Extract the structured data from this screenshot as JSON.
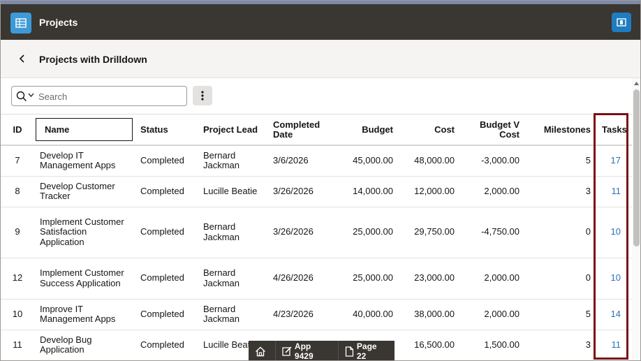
{
  "header": {
    "title": "Projects"
  },
  "subheader": {
    "title": "Projects with Drilldown"
  },
  "search": {
    "placeholder": "Search",
    "value": ""
  },
  "table": {
    "columns": [
      "ID",
      "Name",
      "Status",
      "Project Lead",
      "Completed Date",
      "Budget",
      "Cost",
      "Budget V Cost",
      "Milestones",
      "Tasks"
    ],
    "rows": [
      {
        "id": "7",
        "name": "Develop IT Management Apps",
        "status": "Completed",
        "lead": "Bernard Jackman",
        "date": "3/6/2026",
        "budget": "45,000.00",
        "cost": "48,000.00",
        "bvc": "-3,000.00",
        "milestones": "5",
        "tasks": "17"
      },
      {
        "id": "8",
        "name": "Develop Customer Tracker",
        "status": "Completed",
        "lead": "Lucille Beatie",
        "date": "3/26/2026",
        "budget": "14,000.00",
        "cost": "12,000.00",
        "bvc": "2,000.00",
        "milestones": "3",
        "tasks": "11"
      },
      {
        "id": "9",
        "name": "Implement Customer Satisfaction Application",
        "status": "Completed",
        "lead": "Bernard Jackman",
        "date": "3/26/2026",
        "budget": "25,000.00",
        "cost": "29,750.00",
        "bvc": "-4,750.00",
        "milestones": "0",
        "tasks": "10"
      },
      {
        "id": "12",
        "name": "Implement Customer Success Application",
        "status": "Completed",
        "lead": "Bernard Jackman",
        "date": "4/26/2026",
        "budget": "25,000.00",
        "cost": "23,000.00",
        "bvc": "2,000.00",
        "milestones": "0",
        "tasks": "10"
      },
      {
        "id": "10",
        "name": "Improve IT Management Apps",
        "status": "Completed",
        "lead": "Bernard Jackman",
        "date": "4/23/2026",
        "budget": "40,000.00",
        "cost": "38,000.00",
        "bvc": "2,000.00",
        "milestones": "5",
        "tasks": "14"
      },
      {
        "id": "11",
        "name": "Develop Bug Application",
        "status": "Completed",
        "lead": "Lucille Beatie",
        "date": "",
        "budget": "",
        "cost": "16,500.00",
        "bvc": "1,500.00",
        "milestones": "3",
        "tasks": "11"
      }
    ]
  },
  "devbar": {
    "home": "",
    "app": "App 9429",
    "page": "Page 22"
  },
  "colors": {
    "header_bg": "#3a3631",
    "app_icon": "#3d9ad7",
    "link": "#2c72b3",
    "highlight": "#7a0f16"
  },
  "icons": [
    "menu-icon",
    "user-icon",
    "back-chevron-icon",
    "search-icon",
    "chevron-down-icon",
    "kebab-icon",
    "home-icon",
    "edit-icon",
    "page-icon"
  ]
}
